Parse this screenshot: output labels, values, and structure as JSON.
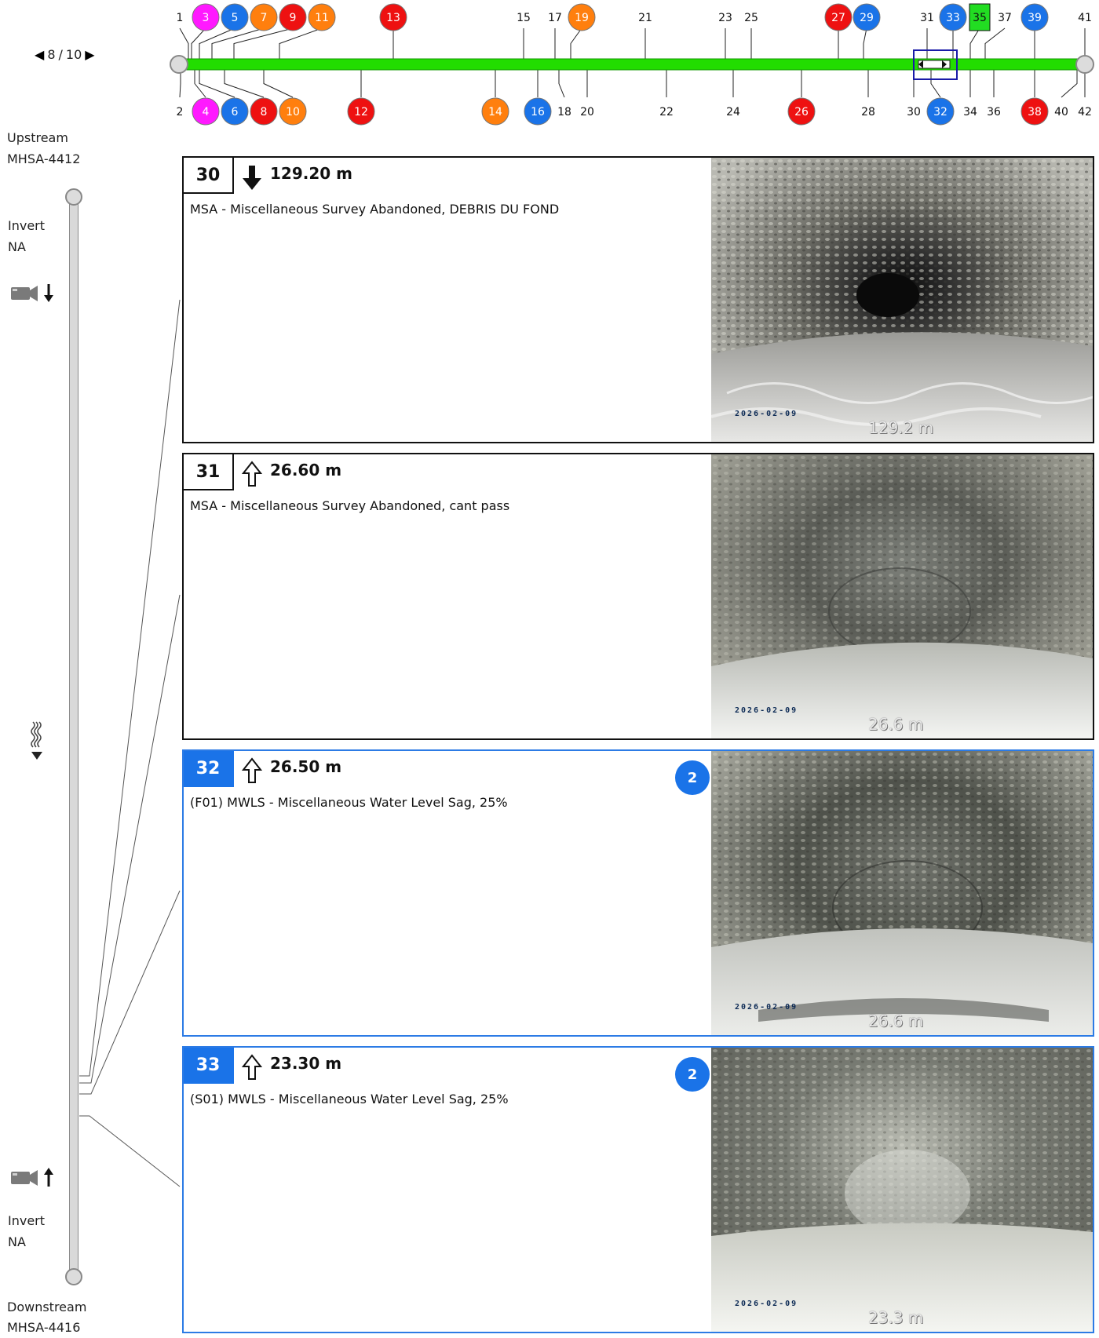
{
  "pager": {
    "current": "8",
    "total": "10",
    "separator": "/"
  },
  "strip": {
    "top_markers": [
      {
        "label": "1",
        "type": "plain"
      },
      {
        "label": "3",
        "type": "circle",
        "color": "#ff19ff"
      },
      {
        "label": "5",
        "type": "circle",
        "color": "#1a73e8"
      },
      {
        "label": "7",
        "type": "circle",
        "color": "#ff7f0e"
      },
      {
        "label": "9",
        "type": "circle",
        "color": "#ee1111"
      },
      {
        "label": "11",
        "type": "circle",
        "color": "#ff7f0e"
      },
      {
        "label": "13",
        "type": "circle",
        "color": "#ee1111"
      },
      {
        "label": "15",
        "type": "plain"
      },
      {
        "label": "17",
        "type": "plain"
      },
      {
        "label": "19",
        "type": "circle",
        "color": "#ff7f0e"
      },
      {
        "label": "21",
        "type": "plain"
      },
      {
        "label": "23",
        "type": "plain"
      },
      {
        "label": "25",
        "type": "plain"
      },
      {
        "label": "27",
        "type": "circle",
        "color": "#ee1111"
      },
      {
        "label": "29",
        "type": "circle",
        "color": "#1a73e8"
      },
      {
        "label": "31",
        "type": "plain"
      },
      {
        "label": "33",
        "type": "circle",
        "color": "#1a73e8"
      },
      {
        "label": "35",
        "type": "square",
        "color": "#22dd22"
      },
      {
        "label": "37",
        "type": "plain"
      },
      {
        "label": "39",
        "type": "circle",
        "color": "#1a73e8"
      },
      {
        "label": "41",
        "type": "plain"
      }
    ],
    "bottom_markers": [
      {
        "label": "2",
        "type": "plain"
      },
      {
        "label": "4",
        "type": "circle",
        "color": "#ff19ff"
      },
      {
        "label": "6",
        "type": "circle",
        "color": "#1a73e8"
      },
      {
        "label": "8",
        "type": "circle",
        "color": "#ee1111"
      },
      {
        "label": "10",
        "type": "circle",
        "color": "#ff7f0e"
      },
      {
        "label": "12",
        "type": "circle",
        "color": "#ee1111"
      },
      {
        "label": "14",
        "type": "circle",
        "color": "#ff7f0e"
      },
      {
        "label": "16",
        "type": "circle",
        "color": "#1a73e8"
      },
      {
        "label": "18",
        "type": "plain"
      },
      {
        "label": "20",
        "type": "plain"
      },
      {
        "label": "22",
        "type": "plain"
      },
      {
        "label": "24",
        "type": "plain"
      },
      {
        "label": "26",
        "type": "circle",
        "color": "#ee1111"
      },
      {
        "label": "28",
        "type": "plain"
      },
      {
        "label": "30",
        "type": "plain"
      },
      {
        "label": "32",
        "type": "circle",
        "color": "#1a73e8"
      },
      {
        "label": "34",
        "type": "plain"
      },
      {
        "label": "36",
        "type": "plain"
      },
      {
        "label": "38",
        "type": "circle",
        "color": "#ee1111"
      },
      {
        "label": "40",
        "type": "plain"
      },
      {
        "label": "42",
        "type": "plain"
      }
    ],
    "pipe_color": "#22dd00"
  },
  "side": {
    "upstream_label": "Upstream",
    "upstream_id": "MHSA-4412",
    "invert_top_label": "Invert",
    "invert_top_value": "NA",
    "invert_bottom_label": "Invert",
    "invert_bottom_value": "NA",
    "downstream_label": "Downstream",
    "downstream_id": "MHSA-4416"
  },
  "observations": [
    {
      "index": "30",
      "direction": "down",
      "distance": "129.20 m",
      "description": "MSA - Miscellaneous Survey Abandoned, DEBRIS DU FOND",
      "badge": "",
      "selected": false,
      "photo_date": "2026-02-09",
      "photo_distance": "129.2 m"
    },
    {
      "index": "31",
      "direction": "up",
      "distance": "26.60 m",
      "description": "MSA - Miscellaneous Survey Abandoned, cant pass",
      "badge": "",
      "selected": false,
      "photo_date": "2026-02-09",
      "photo_distance": "26.6 m"
    },
    {
      "index": "32",
      "direction": "up",
      "distance": "26.50 m",
      "description": "(F01) MWLS - Miscellaneous Water Level Sag, 25%",
      "badge": "2",
      "selected": true,
      "photo_date": "2026-02-09",
      "photo_distance": "26.6 m"
    },
    {
      "index": "33",
      "direction": "up",
      "distance": "23.30 m",
      "description": "(S01) MWLS - Miscellaneous Water Level Sag, 25%",
      "badge": "2",
      "selected": true,
      "photo_date": "2026-02-09",
      "photo_distance": "23.3 m"
    }
  ]
}
